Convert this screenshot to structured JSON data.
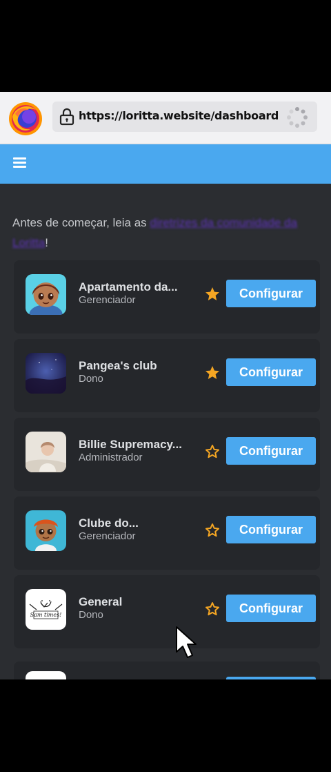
{
  "browser": {
    "url": "https://loritta.website/dashboard",
    "icons": [
      "firefox-logo",
      "lock-icon",
      "loading-spinner"
    ]
  },
  "appbar": {
    "menu_icon": "hamburger-icon",
    "accent_color": "#4aa8ef"
  },
  "intro": {
    "prefix": "Antes de começar, leia as ",
    "link_text": "diretrizes da comunidade da Loritta",
    "suffix": "!"
  },
  "servers": [
    {
      "name": "Apartamento da...",
      "role": "Gerenciador",
      "favorited": true,
      "button_label": "Configurar"
    },
    {
      "name": "Pangea's club",
      "role": "Dono",
      "favorited": true,
      "button_label": "Configurar"
    },
    {
      "name": "Billie Supremacy...",
      "role": "Administrador",
      "favorited": false,
      "button_label": "Configurar"
    },
    {
      "name": "Clube do...",
      "role": "Gerenciador",
      "favorited": false,
      "button_label": "Configurar"
    },
    {
      "name": "General",
      "role": "Dono",
      "favorited": false,
      "button_label": "Configurar",
      "icon_caption": "Sam times!"
    }
  ],
  "colors": {
    "background": "#2b2d31",
    "card": "#25272b",
    "star": "#f5a623",
    "button": "#4aa8ef"
  }
}
